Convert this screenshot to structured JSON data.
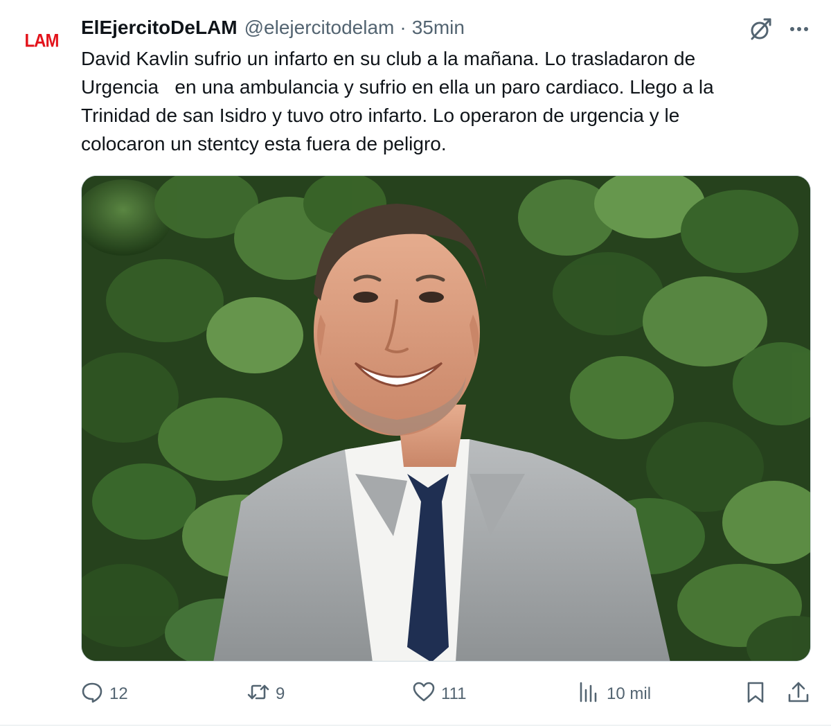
{
  "author": {
    "avatar_text": "LAM",
    "display_name": "ElEjercitoDeLAM",
    "handle": "@elejercitodelam",
    "separator": "·",
    "time": "35min"
  },
  "tweet": {
    "text": "David Kavlin sufrio un infarto en su club a la mañana. Lo trasladaron de\nUrgencia   en una ambulancia y sufrio en ella un paro cardiaco. Llego a la\nTrinidad de san Isidro y tuvo otro infarto. Lo operaron de urgencia y le\ncolocaron un stentcy esta fuera de peligro."
  },
  "media": {
    "icon": "photo-man-in-grey-suit-smiling-before-ivy-wall"
  },
  "actions": {
    "replies": "12",
    "retweets": "9",
    "likes": "111",
    "views": "10 mil"
  },
  "icons": {
    "grok": "grok-icon",
    "more": "more-icon",
    "reply": "reply-icon",
    "retweet": "retweet-icon",
    "like": "heart-icon",
    "views": "views-icon",
    "bookmark": "bookmark-icon",
    "share": "share-icon"
  },
  "colors": {
    "text": "#0f1419",
    "secondary": "#536471",
    "brand": "#e3131b"
  }
}
